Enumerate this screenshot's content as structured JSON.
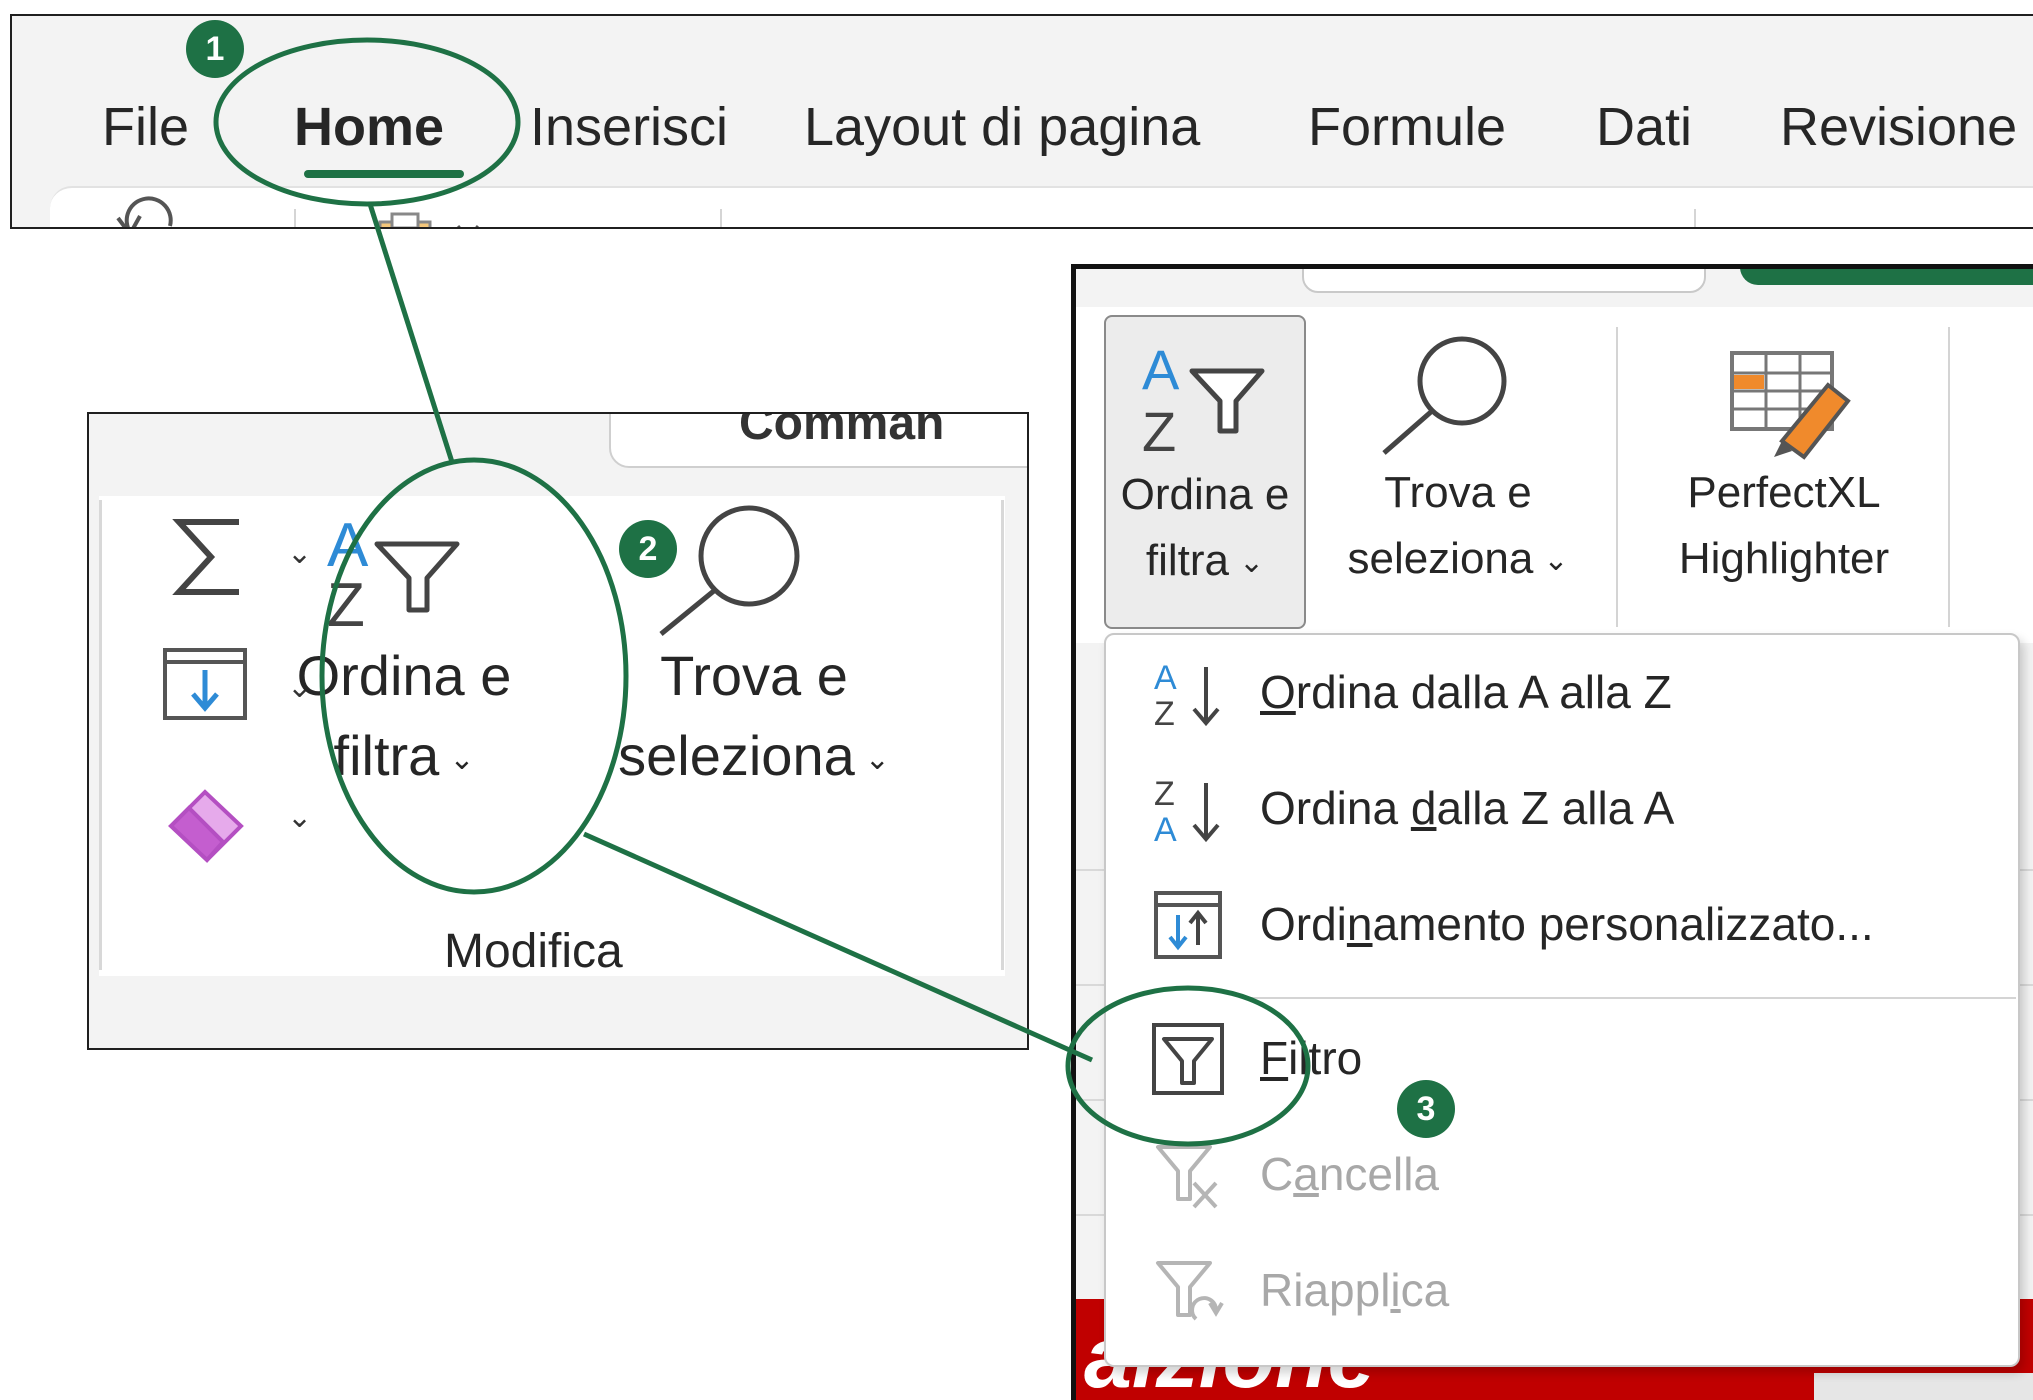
{
  "tabs": {
    "items": [
      {
        "label": "File"
      },
      {
        "label": "Home"
      },
      {
        "label": "Inserisci"
      },
      {
        "label": "Layout di pagina"
      },
      {
        "label": "Formule"
      },
      {
        "label": "Dati"
      },
      {
        "label": "Revisione"
      }
    ],
    "active": "Home"
  },
  "group": {
    "name": "Modifica",
    "partial_top_text": "Comman",
    "sort_filter": {
      "line1": "Ordina e",
      "line2": "filtra"
    },
    "find_select": {
      "line1": "Trova e",
      "line2": "seleziona"
    }
  },
  "ribbon_zoom": {
    "sort_filter": {
      "line1": "Ordina e",
      "line2": "filtra"
    },
    "find_select": {
      "line1": "Trova e",
      "line2": "seleziona"
    },
    "addin": {
      "line1": "PerfectXL",
      "line2": "Highlighter"
    }
  },
  "menu": {
    "items": [
      {
        "label": "Ordina dalla A alla Z",
        "mnemonic": "O",
        "icon": "sort-az-icon",
        "enabled": true
      },
      {
        "label": "Ordina dalla Z alla A",
        "mnemonic": "d",
        "icon": "sort-za-icon",
        "enabled": true
      },
      {
        "label": "Ordinamento personalizzato...",
        "mnemonic": "n",
        "icon": "custom-sort-icon",
        "enabled": true
      },
      {
        "label": "Filtro",
        "mnemonic": "F",
        "icon": "filter-icon",
        "enabled": true
      },
      {
        "label": "Cancella",
        "mnemonic": "a",
        "icon": "clear-filter-icon",
        "enabled": false
      },
      {
        "label": "Riapplica",
        "mnemonic": "i",
        "icon": "reapply-icon",
        "enabled": false
      }
    ]
  },
  "background_text": "aizione",
  "steps": {
    "one": "1",
    "two": "2",
    "three": "3"
  },
  "colors": {
    "accent": "#1e7145",
    "sort_blue": "#2e8bd6",
    "eraser_purple": "#c45ecf",
    "highlighter_orange": "#f08a2c",
    "red_banner": "#c00000",
    "disabled_text": "#a8a8a8"
  }
}
